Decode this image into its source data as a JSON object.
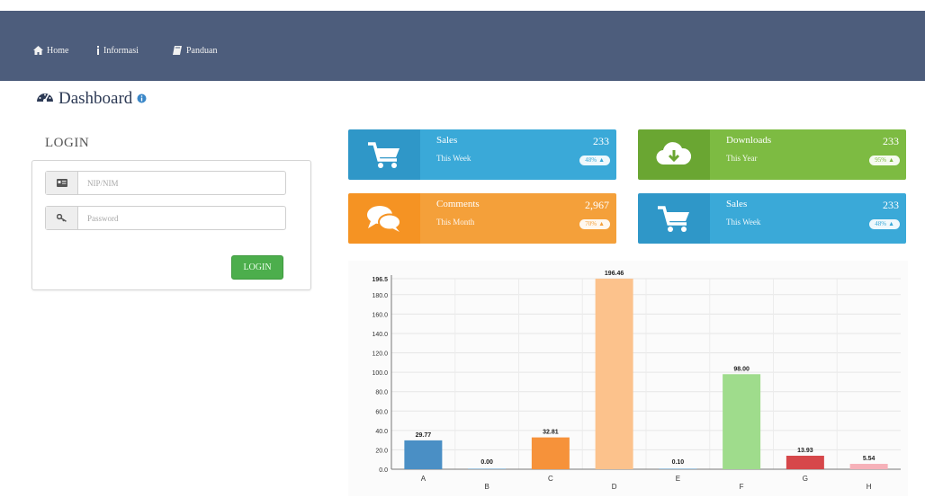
{
  "nav": {
    "items": [
      {
        "label": "Home",
        "icon": "home-icon"
      },
      {
        "label": "Informasi",
        "icon": "info-icon"
      },
      {
        "label": "Panduan",
        "icon": "book-icon"
      }
    ]
  },
  "page": {
    "title": "Dashboard"
  },
  "login": {
    "title": "LOGIN",
    "username_placeholder": "NIP/NIM",
    "password_placeholder": "Password",
    "button_label": "LOGIN"
  },
  "tiles": [
    {
      "title": "Sales",
      "subtitle": "This Week",
      "value": "233",
      "badge": "48%",
      "color": "#3aa9d8",
      "icon": "cart-icon"
    },
    {
      "title": "Downloads",
      "subtitle": "This Year",
      "value": "233",
      "badge": "95%",
      "color": "#7dbb42",
      "icon": "cloud-download-icon"
    },
    {
      "title": "Comments",
      "subtitle": "This Month",
      "value": "2,967",
      "badge": "70%",
      "color": "#f4a03a",
      "icon": "comments-icon"
    },
    {
      "title": "Sales",
      "subtitle": "This Week",
      "value": "233",
      "badge": "48%",
      "color": "#3aa9d8",
      "icon": "cart-icon"
    }
  ],
  "chart_data": {
    "type": "bar",
    "categories": [
      "A",
      "B",
      "C",
      "D",
      "E",
      "F",
      "G",
      "H"
    ],
    "values": [
      29.77,
      0.0,
      32.81,
      196.46,
      0.1,
      98.0,
      13.93,
      5.54
    ],
    "value_labels": [
      "29.77",
      "0.00",
      "32.81",
      "196.46",
      "0.10",
      "98.00",
      "13.93",
      "5.54"
    ],
    "colors": [
      "#4a8fc5",
      "#4a8fc5",
      "#f6923a",
      "#fcc28c",
      "#4a8fc5",
      "#9fdc8c",
      "#d6474a",
      "#f6b1b9"
    ],
    "yticks": [
      "0.0",
      "20.0",
      "40.0",
      "60.0",
      "80.0",
      "100.0",
      "120.0",
      "140.0",
      "160.0",
      "180.0",
      "196.5"
    ],
    "ylim": [
      0,
      196.5
    ],
    "grid": true,
    "title": "",
    "xlabel": "",
    "ylabel": ""
  }
}
